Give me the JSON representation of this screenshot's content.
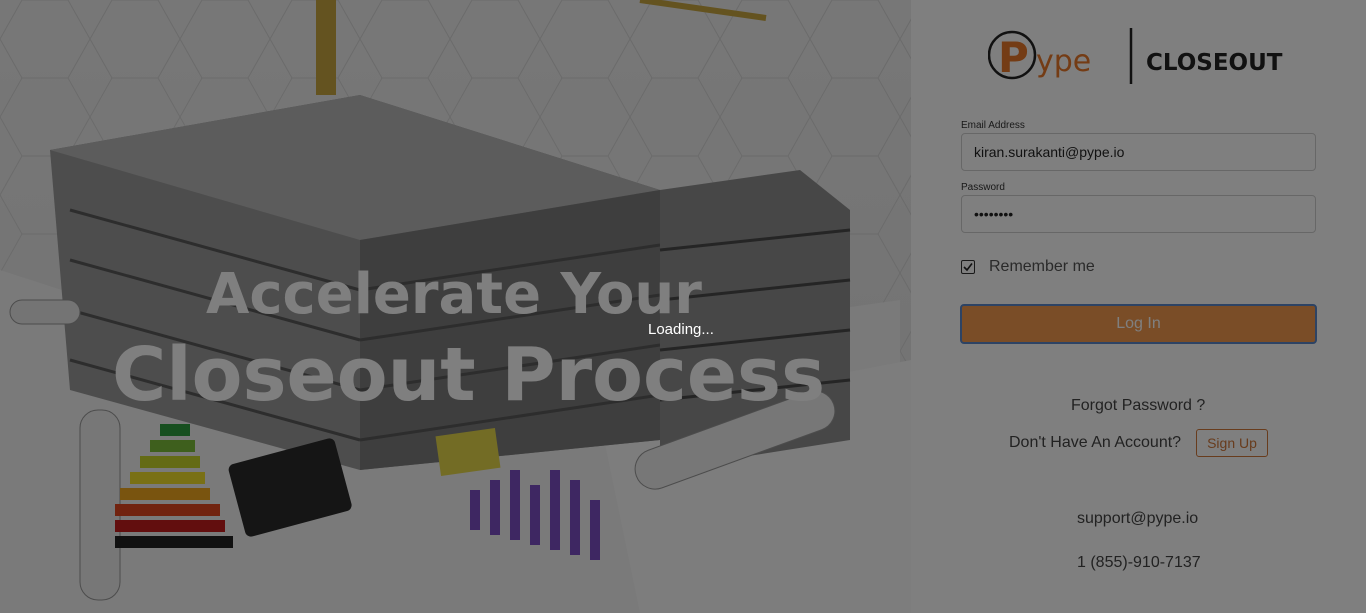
{
  "hero": {
    "headline_line1": "Accelerate Your",
    "headline_line2": "Closeout Process"
  },
  "logo": {
    "brand": "ype",
    "brand_initial": "P",
    "product": "CLOSEOUT",
    "accent_color": "#e8792b"
  },
  "login_form": {
    "email_label": "Email Address",
    "email_value": "kiran.surakanti@pype.io",
    "password_label": "Password",
    "password_value": "••••••••",
    "remember_label": "Remember me",
    "remember_checked": true,
    "login_button": "Log In",
    "forgot_password": "Forgot Password ?",
    "no_account_text": "Don't Have An Account?",
    "signup_button": "Sign Up"
  },
  "contact": {
    "email": "support@pype.io",
    "phone": "1 (855)-910-7137"
  },
  "overlay": {
    "loading_text": "Loading..."
  },
  "colors": {
    "button": "#f59a4e",
    "button_border": "#5a86c8",
    "overlay": "rgba(0,0,0,0.5)"
  }
}
